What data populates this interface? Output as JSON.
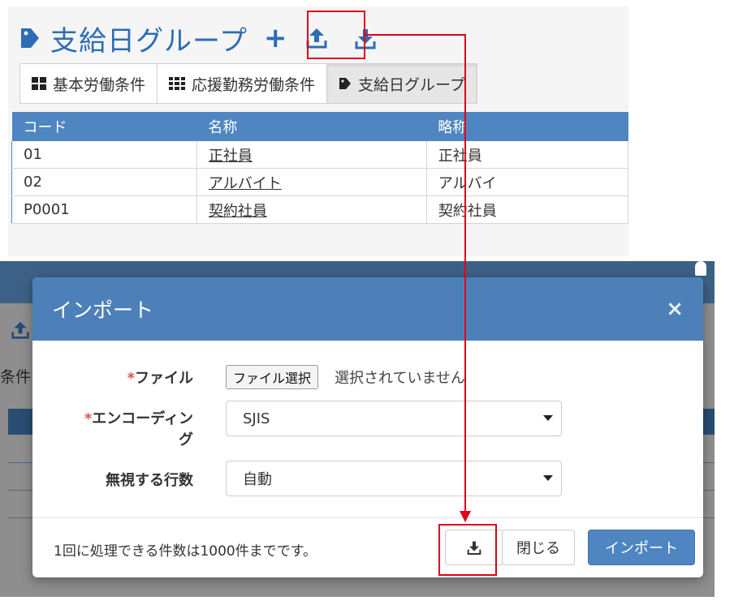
{
  "page": {
    "title": "支給日グループ"
  },
  "tabs": [
    {
      "label": "基本労働条件",
      "icon": "grid-4-icon"
    },
    {
      "label": "応援勤務労働条件",
      "icon": "grid-9-icon"
    },
    {
      "label": "支給日グループ",
      "icon": "tag-icon",
      "active": true
    }
  ],
  "table": {
    "columns": [
      "コード",
      "名称",
      "略称"
    ],
    "rows": [
      {
        "code": "01",
        "name": "正社員",
        "short": "正社員"
      },
      {
        "code": "02",
        "name": "アルバイト",
        "short": "アルバイ"
      },
      {
        "code": "P0001",
        "name": "契約社員",
        "short": "契約社員"
      }
    ]
  },
  "background": {
    "side_text": "条件"
  },
  "modal": {
    "title": "インポート",
    "close_symbol": "×",
    "file_label": "ファイル",
    "file_button": "ファイル選択",
    "file_status": "選択されていません",
    "encoding_label": "エンコーディング",
    "encoding_value": "SJIS",
    "skip_rows_label": "無視する行数",
    "skip_rows_value": "自動",
    "required_mark": "*",
    "footer_note": "1回に処理できる件数は1000件までです。",
    "close_button": "閉じる",
    "import_button": "インポート"
  },
  "colors": {
    "primary": "#4f86c1",
    "title_blue": "#2c6db3",
    "annotation_red": "#e0001b"
  }
}
